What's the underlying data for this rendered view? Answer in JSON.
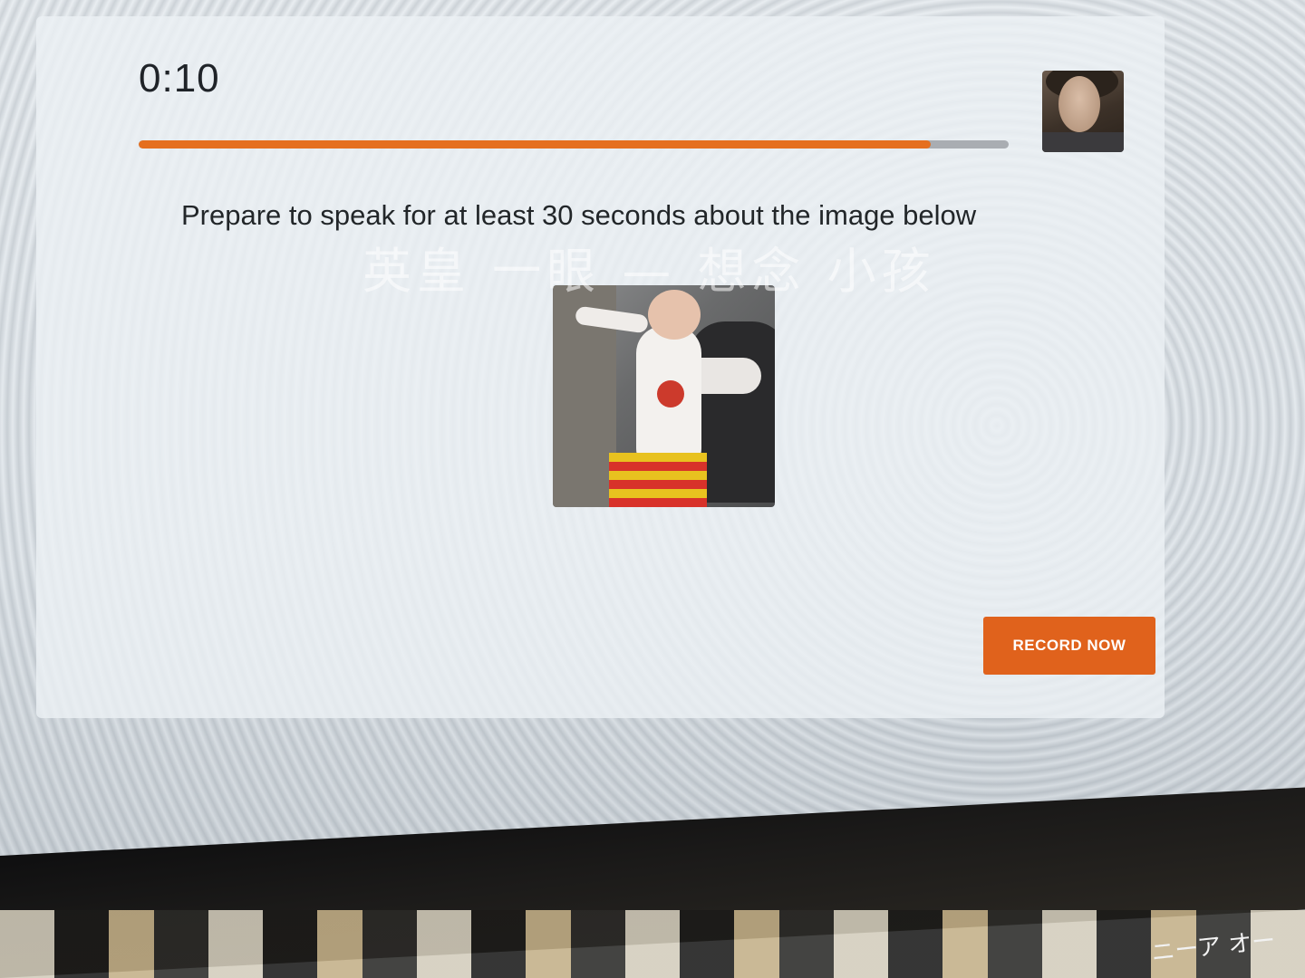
{
  "timer": {
    "text": "0:10"
  },
  "progress": {
    "fraction": 0.91,
    "fill_color": "#e56f1f",
    "track_color": "#a9adb2"
  },
  "prompt": {
    "text": "Prepare to speak for at least 30 seconds about the image below"
  },
  "stimulus_image": {
    "subject": "baby-standing-on-block-photo"
  },
  "webcam": {
    "subject": "webcam-preview-thumbnail"
  },
  "actions": {
    "record_label": "RECORD NOW",
    "record_color": "#e0621c"
  },
  "watermark": {
    "text": "英皇 一眼 — 想念 小孩"
  },
  "background_text": {
    "poster_text": "ニーア オー"
  }
}
